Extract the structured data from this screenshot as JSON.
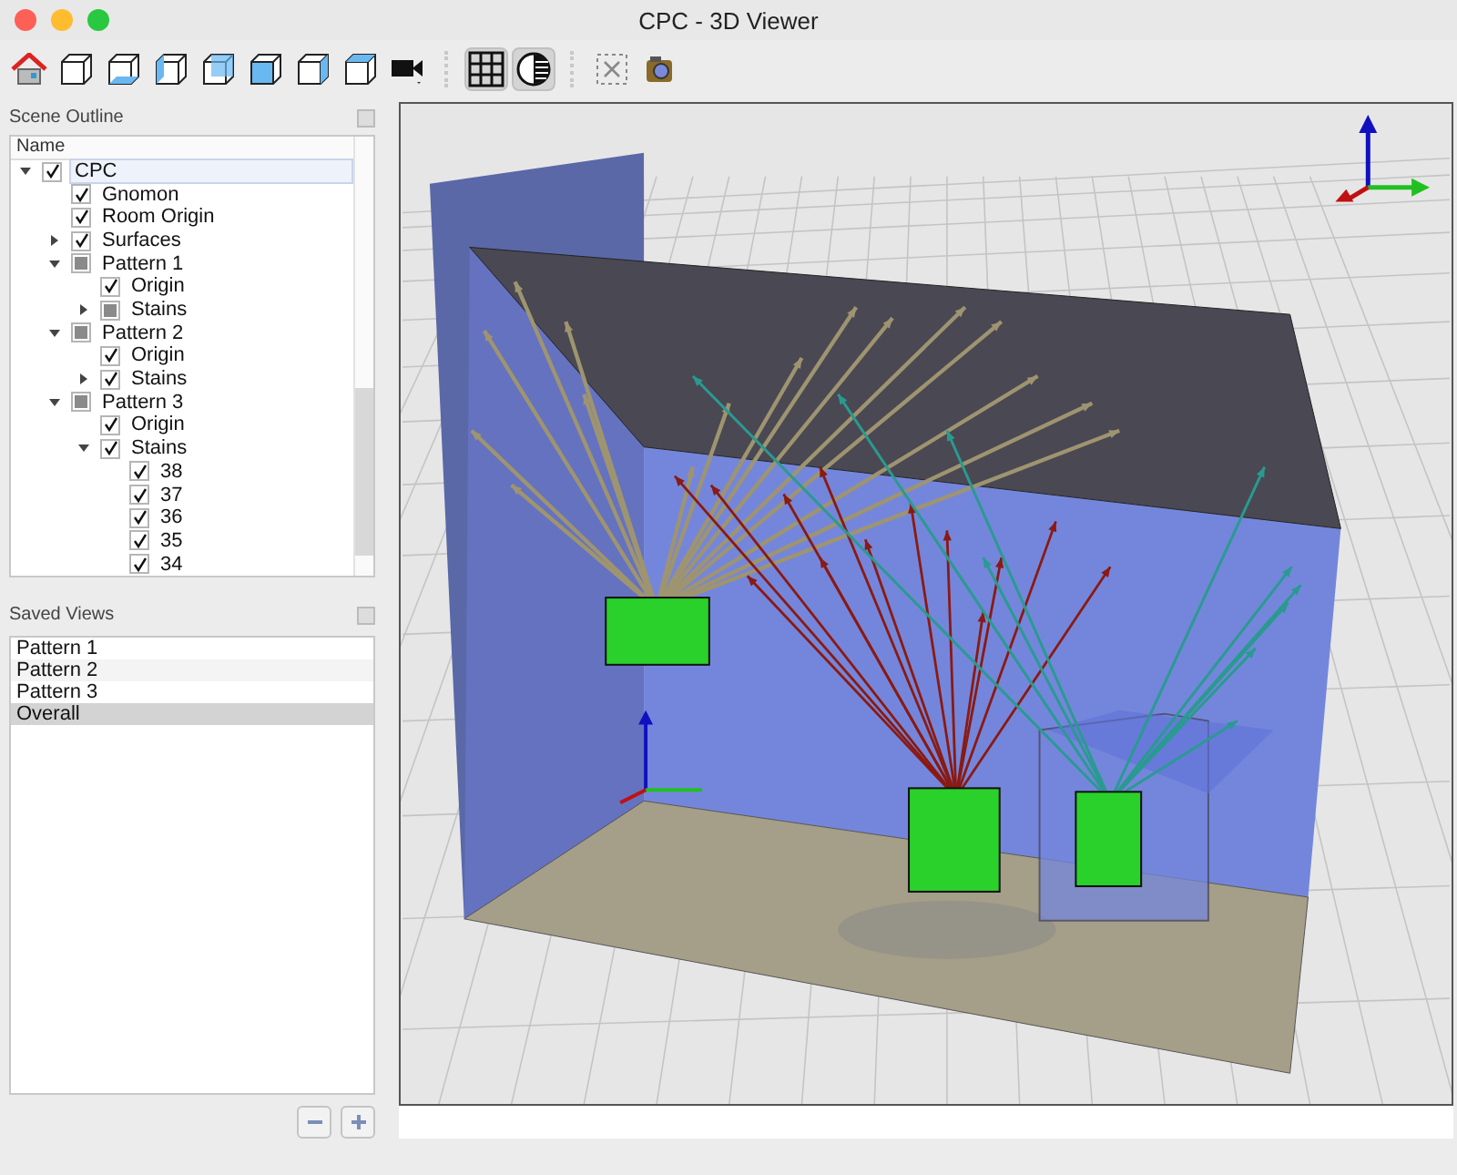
{
  "window": {
    "title": "CPC - 3D Viewer"
  },
  "toolbar": [
    {
      "kind": "home",
      "selected": false
    },
    {
      "kind": "cube",
      "selected": false
    },
    {
      "kind": "cube",
      "selected": false
    },
    {
      "kind": "cube",
      "selected": false
    },
    {
      "kind": "cube",
      "selected": false
    },
    {
      "kind": "cube",
      "selected": false
    },
    {
      "kind": "cube",
      "selected": false
    },
    {
      "kind": "cube",
      "selected": false
    },
    {
      "kind": "camera",
      "selected": false
    },
    {
      "kind": "grid",
      "selected": true
    },
    {
      "kind": "shading",
      "selected": true
    },
    {
      "kind": "clear",
      "selected": false
    },
    {
      "kind": "snapshot",
      "selected": false
    }
  ],
  "scene_outline": {
    "title": "Scene Outline",
    "column": "Name",
    "items": [
      {
        "label": "CPC",
        "checked": true,
        "mixed": false,
        "selected": true,
        "expanded": true,
        "children": [
          {
            "label": "Gnomon",
            "checked": true,
            "mixed": false,
            "selected": false
          },
          {
            "label": "Room Origin",
            "checked": true,
            "mixed": false,
            "selected": false
          },
          {
            "label": "Surfaces",
            "checked": true,
            "mixed": false,
            "selected": false,
            "expanded": false
          },
          {
            "label": "Pattern 1",
            "checked": false,
            "mixed": true,
            "selected": false,
            "expanded": true,
            "children": [
              {
                "label": "Origin",
                "checked": true,
                "mixed": false,
                "selected": false
              },
              {
                "label": "Stains",
                "checked": false,
                "mixed": true,
                "selected": false,
                "expanded": false
              }
            ]
          },
          {
            "label": "Pattern 2",
            "checked": false,
            "mixed": true,
            "selected": false,
            "expanded": true,
            "children": [
              {
                "label": "Origin",
                "checked": true,
                "mixed": false,
                "selected": false
              },
              {
                "label": "Stains",
                "checked": true,
                "mixed": false,
                "selected": false,
                "expanded": false
              }
            ]
          },
          {
            "label": "Pattern 3",
            "checked": false,
            "mixed": true,
            "selected": false,
            "expanded": true,
            "children": [
              {
                "label": "Origin",
                "checked": true,
                "mixed": false,
                "selected": false
              },
              {
                "label": "Stains",
                "checked": true,
                "mixed": false,
                "selected": false,
                "expanded": true,
                "children": [
                  {
                    "label": "38",
                    "checked": true,
                    "mixed": false,
                    "selected": false
                  },
                  {
                    "label": "37",
                    "checked": true,
                    "mixed": false,
                    "selected": false
                  },
                  {
                    "label": "36",
                    "checked": true,
                    "mixed": false,
                    "selected": false
                  },
                  {
                    "label": "35",
                    "checked": true,
                    "mixed": false,
                    "selected": false
                  },
                  {
                    "label": "34",
                    "checked": true,
                    "mixed": false,
                    "selected": false
                  }
                ]
              }
            ]
          }
        ]
      }
    ]
  },
  "saved_views": {
    "title": "Saved Views",
    "items": [
      {
        "label": "Pattern 1",
        "selected": false
      },
      {
        "label": "Pattern 2",
        "selected": false
      },
      {
        "label": "Pattern 3",
        "selected": false
      },
      {
        "label": "Overall",
        "selected": true
      }
    ]
  }
}
